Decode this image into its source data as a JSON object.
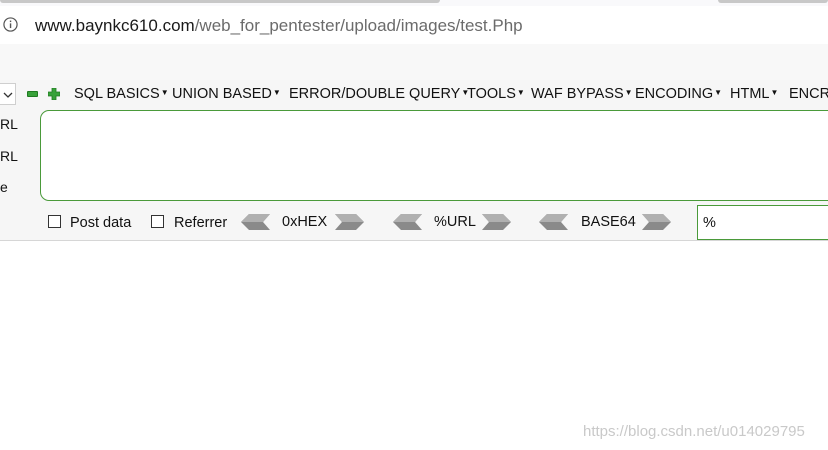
{
  "address_bar": {
    "host": "www.baynkc610.com",
    "path": "/web_for_pentester/upload/images/test.Php",
    "info_icon": "info-icon"
  },
  "hackbar": {
    "side_labels": [
      "RL",
      "RL",
      "e"
    ],
    "menu": [
      {
        "label": "SQL BASICS"
      },
      {
        "label": "UNION BASED"
      },
      {
        "label": "ERROR/DOUBLE QUERY"
      },
      {
        "label": "TOOLS"
      },
      {
        "label": "WAF BYPASS"
      },
      {
        "label": "ENCODING"
      },
      {
        "label": "HTML"
      },
      {
        "label": "ENCRY"
      }
    ],
    "textarea_value": "",
    "post_data_label": "Post data",
    "referrer_label": "Referrer",
    "converters": [
      "0xHEX",
      "%URL",
      "BASE64"
    ],
    "result_value": "%"
  },
  "watermark": "https://blog.csdn.net/u014029795",
  "colors": {
    "accent_green": "#4a9a3a",
    "icon_green": "#38a13a",
    "arrow_gray": "#8a8a8a"
  }
}
